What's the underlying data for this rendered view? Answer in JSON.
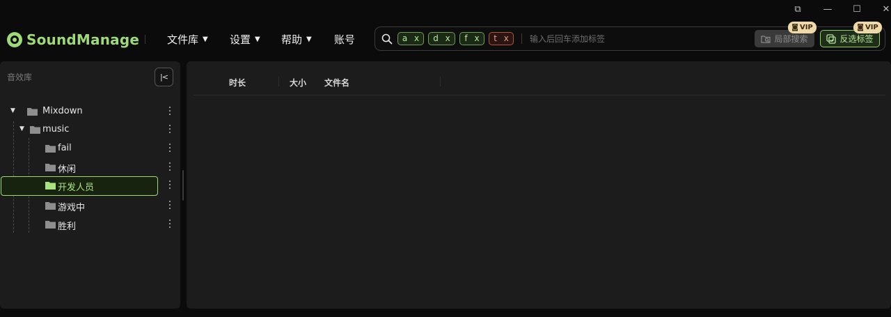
{
  "window": {
    "controls": {
      "restore_icon": "⧉",
      "minimize_icon": "—",
      "maximize_icon": "☐",
      "close_icon": "✕"
    }
  },
  "app": {
    "name": "SoundManage",
    "accent_color": "#9ed97a"
  },
  "menu": {
    "items": [
      {
        "label": "文件库",
        "has_dropdown": true
      },
      {
        "label": "设置",
        "has_dropdown": true
      },
      {
        "label": "帮助",
        "has_dropdown": true
      },
      {
        "label": "账号",
        "has_dropdown": false
      }
    ]
  },
  "search": {
    "tags": [
      {
        "label": "a x",
        "color": "green"
      },
      {
        "label": "d x",
        "color": "green"
      },
      {
        "label": "f x",
        "color": "green"
      },
      {
        "label": "t x",
        "color": "red"
      }
    ],
    "placeholder": "输入后回车添加标签",
    "local_search_label": "局部搜索",
    "invert_tags_label": "反选标签",
    "vip_label": "VIP"
  },
  "library": {
    "title": "音效库",
    "collapse_label": "|<",
    "tree": [
      {
        "label": "Mixdown",
        "level": 0,
        "expanded": true,
        "selected": false
      },
      {
        "label": "music",
        "level": 1,
        "expanded": true,
        "selected": false
      },
      {
        "label": "fail",
        "level": 2,
        "selected": false
      },
      {
        "label": "休闲",
        "level": 2,
        "selected": false
      },
      {
        "label": "开发人员",
        "level": 2,
        "selected": true
      },
      {
        "label": "游戏中",
        "level": 2,
        "selected": false
      },
      {
        "label": "胜利",
        "level": 2,
        "selected": false
      }
    ]
  },
  "file_table": {
    "columns": [
      "时长",
      "大小",
      "文件名"
    ],
    "rows": []
  }
}
